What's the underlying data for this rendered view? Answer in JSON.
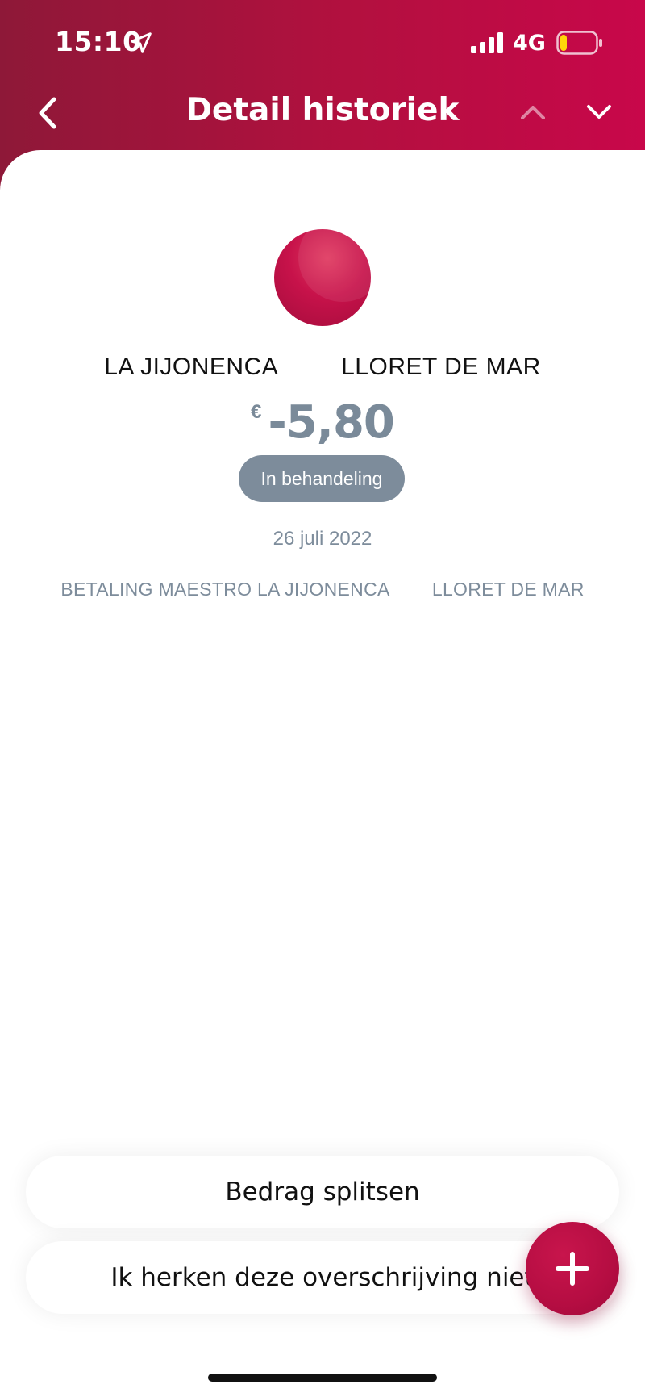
{
  "status_bar": {
    "time": "15:10",
    "network": "4G",
    "location_icon": "location-arrow-icon",
    "signal_icon": "signal-bars-icon",
    "battery_icon": "battery-low-icon",
    "battery_level": 0.2,
    "battery_color": "#ffd60a"
  },
  "header": {
    "title": "Detail historiek",
    "back_icon": "chevron-left-icon",
    "prev_icon": "chevron-up-icon",
    "next_icon": "chevron-down-icon",
    "gradient_start": "#8e1838",
    "gradient_end": "#c8074a"
  },
  "transaction": {
    "merchant": "LA JIJONENCA         LLORET DE MAR",
    "currency": "€",
    "amount": "-5,80",
    "status": "In behandeling",
    "date": "26 juli 2022",
    "description": "BETALING MAESTRO LA JIJONENCA        LLORET DE MAR"
  },
  "actions": {
    "split": "Bedrag splitsen",
    "dispute": "Ik herken deze overschrijving niet",
    "fab_icon": "plus-icon",
    "accent": "#b50d42"
  }
}
